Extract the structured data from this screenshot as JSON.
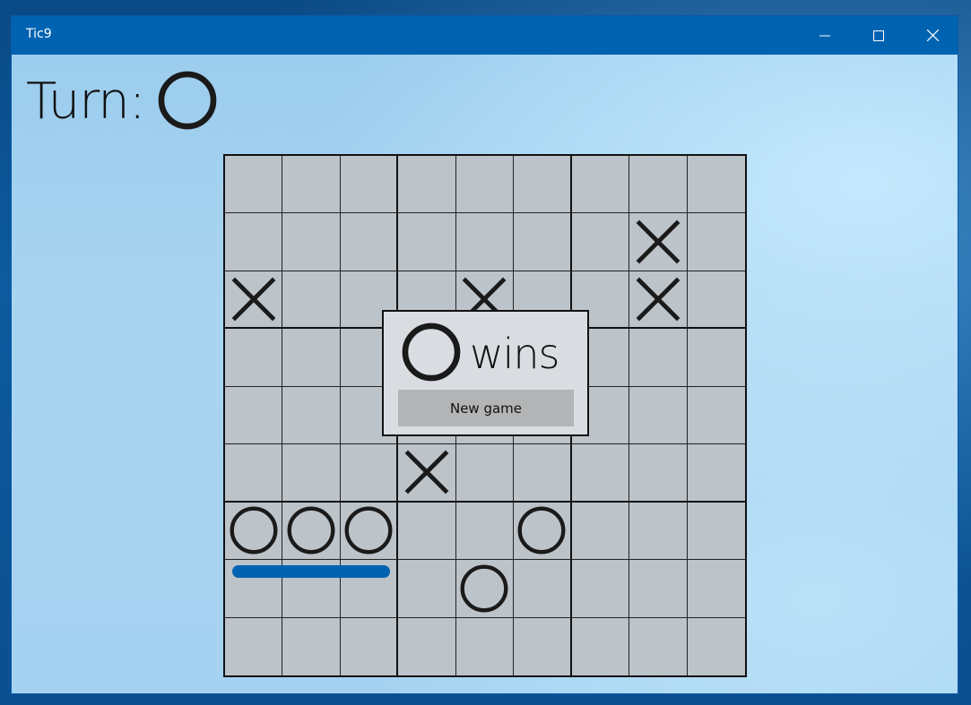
{
  "window": {
    "title": "Tic9",
    "titlebar_color": "#0063b1",
    "controls": [
      "minimize-icon",
      "maximize-icon",
      "close-icon"
    ]
  },
  "status": {
    "turn_label": "Turn:",
    "current_turn": "O"
  },
  "board": {
    "size": 9,
    "subgrid": 3,
    "cells": [
      [
        "",
        "",
        "",
        "",
        "",
        "",
        "",
        "",
        ""
      ],
      [
        "",
        "",
        "",
        "",
        "",
        "",
        "",
        "X",
        ""
      ],
      [
        "X",
        "",
        "",
        "",
        "X",
        "",
        "",
        "X",
        ""
      ],
      [
        "",
        "",
        "",
        "",
        "",
        "",
        "",
        "",
        ""
      ],
      [
        "",
        "",
        "",
        "",
        "",
        "",
        "",
        "",
        ""
      ],
      [
        "",
        "",
        "",
        "X",
        "",
        "",
        "",
        "",
        ""
      ],
      [
        "O",
        "O",
        "O",
        "",
        "",
        "O",
        "",
        "",
        ""
      ],
      [
        "",
        "",
        "",
        "",
        "O",
        "",
        "",
        "",
        ""
      ],
      [
        "",
        "",
        "",
        "",
        "",
        "",
        "",
        "",
        ""
      ]
    ],
    "winning_line": {
      "row": 6,
      "from_col": 0,
      "to_col": 2,
      "color": "#0063b1"
    }
  },
  "dialog": {
    "winner": "O",
    "wins_label": "wins",
    "new_game_label": "New game"
  }
}
